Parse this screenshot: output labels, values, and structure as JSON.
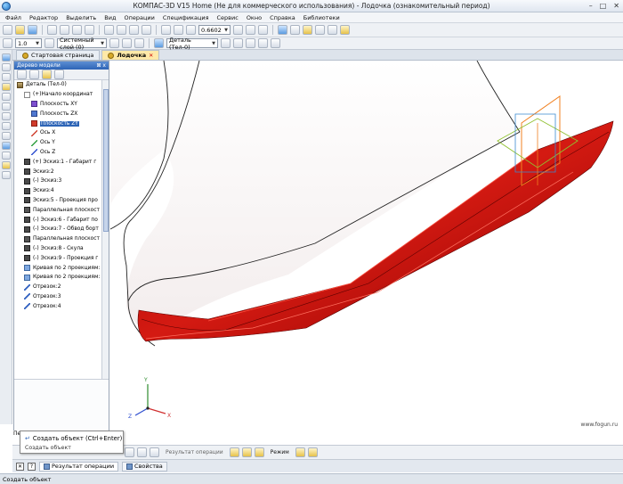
{
  "window": {
    "title": "КОМПАС-3D V15 Home (Не для коммерческого использования) - Лодочка (ознакомительный период)",
    "controls": [
      "–",
      "□",
      "✕"
    ]
  },
  "menu": [
    "Файл",
    "Редактор",
    "Выделить",
    "Вид",
    "Операции",
    "Спецификация",
    "Сервис",
    "Окно",
    "Справка",
    "Библиотеки"
  ],
  "toolbar": {
    "zoom_value": "0.6602",
    "line_scale": "1.0",
    "coord_system": "Системный слой (0)",
    "part_select": "Деталь (Тел-0)"
  },
  "tabs": [
    {
      "label": "Стартовая страница",
      "active": false
    },
    {
      "label": "Лодочка",
      "active": true
    }
  ],
  "tree": {
    "title": "Дерево модели",
    "pin": "⊠ x",
    "items": [
      {
        "label": "Деталь (Тел-0)",
        "icon": "part",
        "indent": 0
      },
      {
        "label": "(+)Начало координат",
        "icon": "origin",
        "indent": 1
      },
      {
        "label": "Плоскость XY",
        "icon": "plane-xy",
        "indent": 2
      },
      {
        "label": "Плоскость ZX",
        "icon": "plane-zx",
        "indent": 2
      },
      {
        "label": "Плоскость ZY",
        "icon": "plane-zy",
        "indent": 2,
        "selected": true
      },
      {
        "label": "Ось X",
        "icon": "axis-x",
        "indent": 2
      },
      {
        "label": "Ось Y",
        "icon": "axis-y",
        "indent": 2
      },
      {
        "label": "Ось Z",
        "icon": "axis-z",
        "indent": 2
      },
      {
        "label": "(+) Эскиз:1 - Габарит г",
        "icon": "sketch",
        "indent": 1
      },
      {
        "label": "Эскиз:2",
        "icon": "sketch",
        "indent": 1
      },
      {
        "label": "(-) Эскиз:3",
        "icon": "sketch",
        "indent": 1
      },
      {
        "label": "Эскиз:4",
        "icon": "sketch",
        "indent": 1
      },
      {
        "label": "Эскиз:5 - Проекция про",
        "icon": "sketch",
        "indent": 1
      },
      {
        "label": "Параллельная плоскост",
        "icon": "plane-par",
        "indent": 1
      },
      {
        "label": "(-) Эскиз:6 - Габарит по",
        "icon": "sketch",
        "indent": 1
      },
      {
        "label": "(-) Эскиз:7 - Обвод борт",
        "icon": "sketch",
        "indent": 1
      },
      {
        "label": "Параллельная плоскост",
        "icon": "plane-par",
        "indent": 1
      },
      {
        "label": "(-) Эскиз:8 - Скула",
        "icon": "sketch",
        "indent": 1
      },
      {
        "label": "(-) Эскиз:9 - Проекция г",
        "icon": "sketch",
        "indent": 1
      },
      {
        "label": "Кривая по 2 проекциям:",
        "icon": "curve",
        "indent": 1
      },
      {
        "label": "Кривая по 2 проекциям:",
        "icon": "curve",
        "indent": 1
      },
      {
        "label": "Отрезок:2",
        "icon": "segment",
        "indent": 1
      },
      {
        "label": "Отрезок:3",
        "icon": "segment",
        "indent": 1
      },
      {
        "label": "Отрезок:4",
        "icon": "segment",
        "indent": 1
      }
    ]
  },
  "tooltip": {
    "title": "Создать объект (Ctrl+Enter)",
    "subtitle": "Создать объект"
  },
  "propbar_stub": "Пе",
  "bottom": {
    "result_label": "Результат операции",
    "mode_label": "Режим"
  },
  "bottom_tabs": [
    {
      "label": "Результат операции",
      "active": true
    },
    {
      "label": "Свойства",
      "active": false
    }
  ],
  "status": "Создать объект",
  "watermark": "www.fogun.ru",
  "colors": {
    "hull": "#c41410",
    "hull_dark": "#7a0000",
    "selection": "#2d64b6"
  }
}
